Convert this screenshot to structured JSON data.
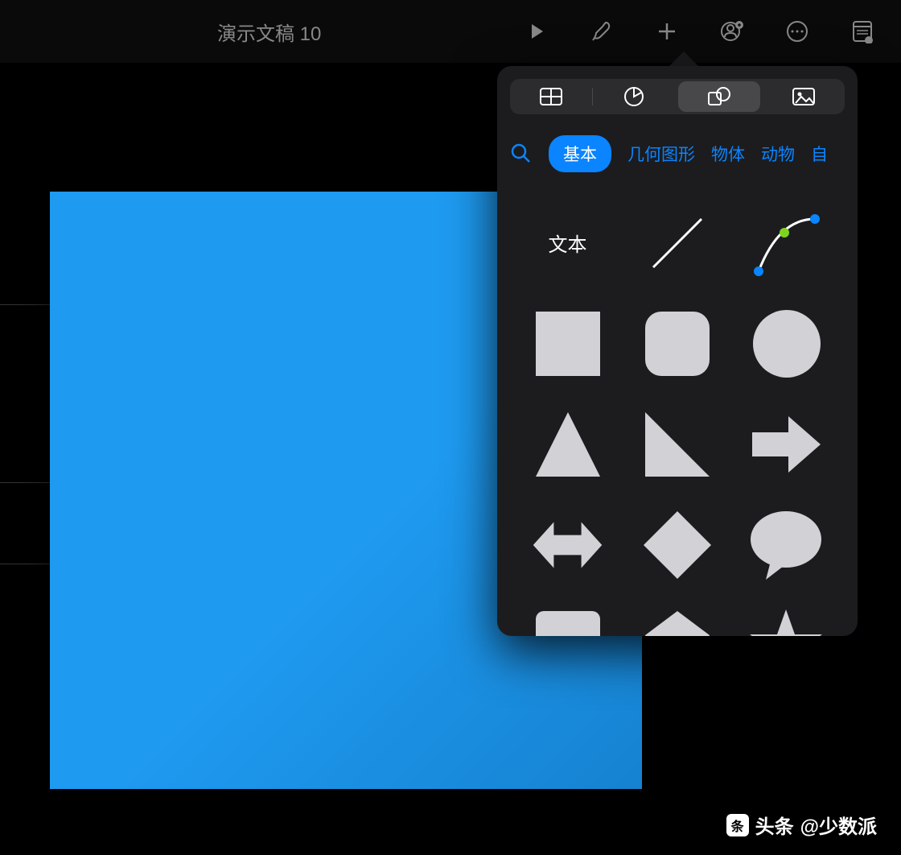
{
  "document": {
    "title": "演示文稿 10"
  },
  "toolbar": {
    "icons": [
      "play",
      "brush",
      "plus",
      "collaborate",
      "more",
      "format"
    ]
  },
  "popover": {
    "tabs": [
      "table",
      "chart",
      "shapes",
      "media"
    ],
    "activeTab": 2,
    "categories": [
      "基本",
      "几何图形",
      "物体",
      "动物",
      "自"
    ],
    "activeCategory": 0,
    "textLabel": "文本",
    "shapes": [
      "text",
      "line",
      "curve",
      "square",
      "rounded-square",
      "circle",
      "triangle",
      "right-triangle",
      "arrow-right",
      "arrow-bidirectional",
      "diamond",
      "speech-bubble",
      "callout",
      "pentagon",
      "star"
    ]
  },
  "watermark": {
    "prefix": "头条",
    "handle": "@少数派"
  }
}
